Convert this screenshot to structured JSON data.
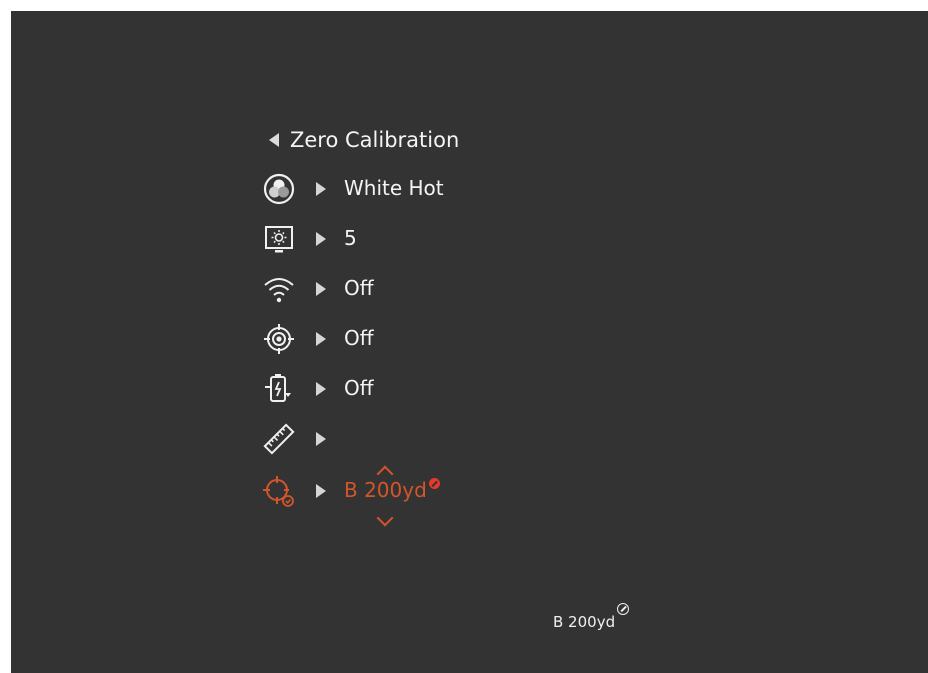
{
  "menu": {
    "title": "Zero Calibration",
    "rows": [
      {
        "icon": "palette-icon",
        "value": "White Hot"
      },
      {
        "icon": "brightness-icon",
        "value": "5"
      },
      {
        "icon": "wifi-icon",
        "value": "Off"
      },
      {
        "icon": "reticle-icon",
        "value": "Off"
      },
      {
        "icon": "battery-swap-icon",
        "value": "Off"
      },
      {
        "icon": "ruler-icon",
        "value": ""
      },
      {
        "icon": "zero-target-icon",
        "value": "B 200yd",
        "selected": true
      }
    ]
  },
  "status": {
    "profile": "B 200yd"
  },
  "colors": {
    "background": "#333333",
    "accent": "#d2552b",
    "text": "#f4f4f4"
  }
}
